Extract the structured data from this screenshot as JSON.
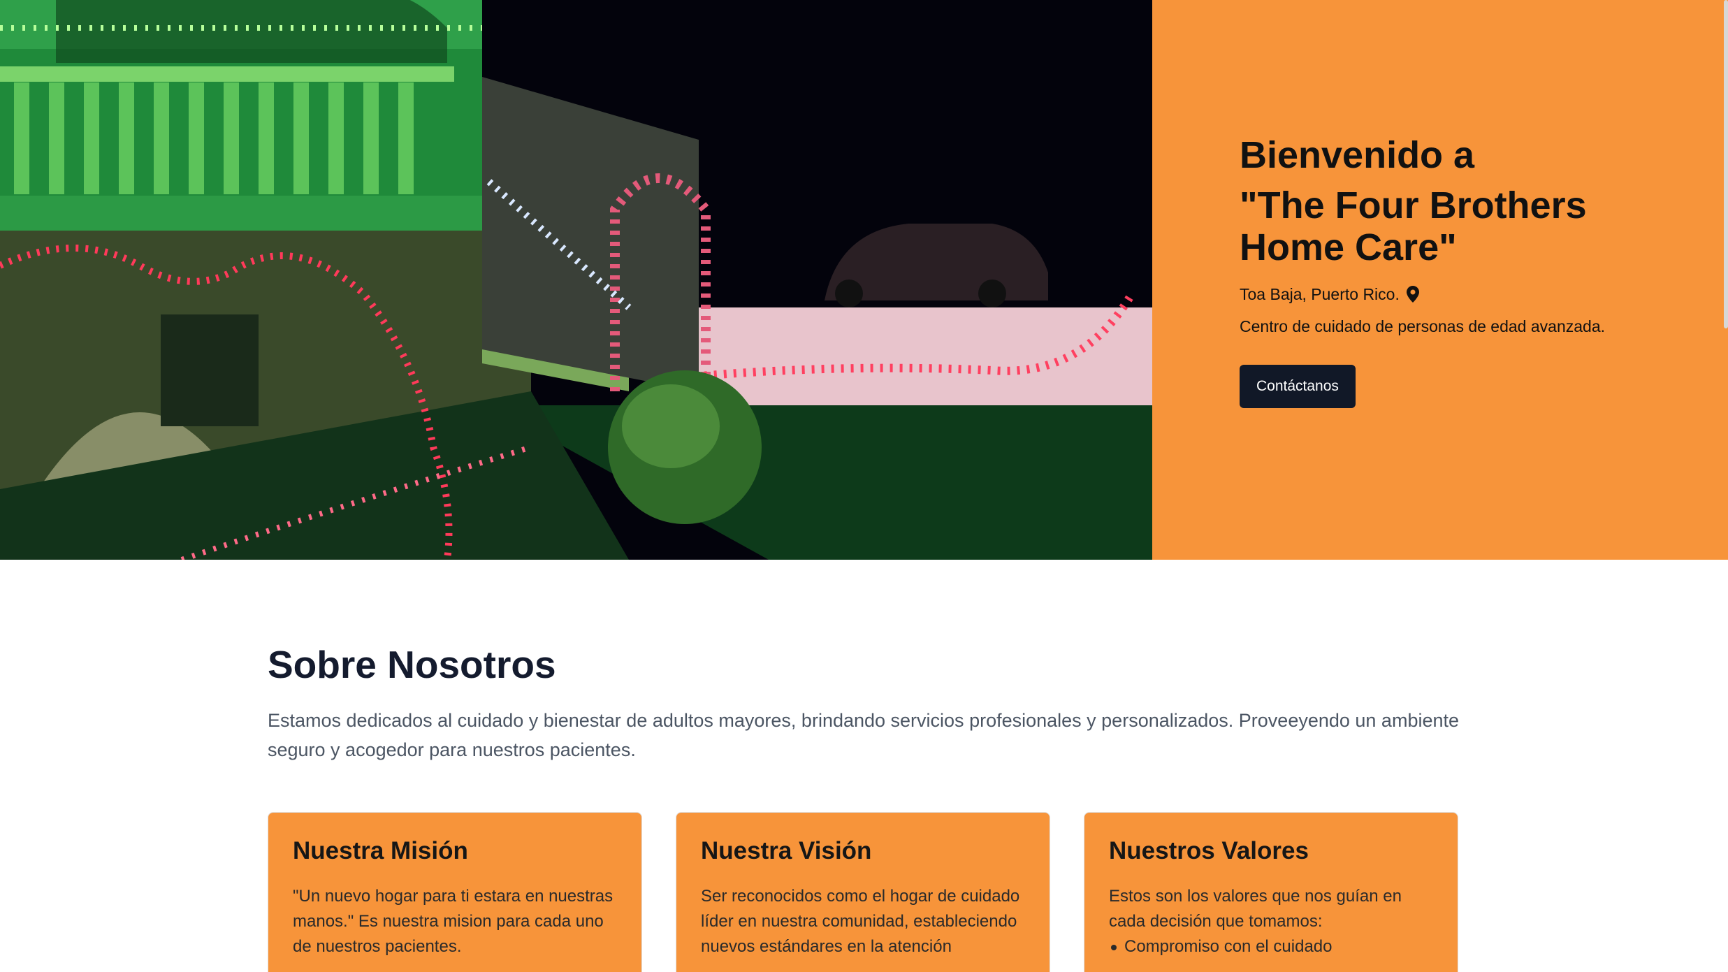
{
  "hero": {
    "title_line1": "Bienvenido a",
    "title_line2": "\"The Four Brothers",
    "title_line3": "Home Care\"",
    "location": "Toa Baja, Puerto Rico.",
    "description": "Centro de cuidado de personas de edad avanzada.",
    "cta_label": "Contáctanos",
    "panel_color": "#f7943a",
    "cta_color": "#111827"
  },
  "about": {
    "title": "Sobre Nosotros",
    "text": "Estamos dedicados al cuidado y bienestar de adultos mayores, brindando servicios profesionales y personalizados. Proveeyendo un ambiente seguro y acogedor para nuestros pacientes."
  },
  "cards": [
    {
      "title": "Nuestra Misión",
      "text": "\"Un nuevo hogar para ti estara en nuestras manos.\" Es nuestra mision para cada uno de nuestros pacientes."
    },
    {
      "title": "Nuestra Visión",
      "text": "Ser reconocidos como el hogar de cuidado líder en nuestra comunidad, estableciendo nuevos estándares en la atención"
    },
    {
      "title": "Nuestros Valores",
      "text": "Estos son los valores que nos guían en cada decisión que tomamos:",
      "items": [
        "Compromiso con el cuidado"
      ]
    }
  ],
  "icons": {
    "location": "map-pin-icon"
  }
}
